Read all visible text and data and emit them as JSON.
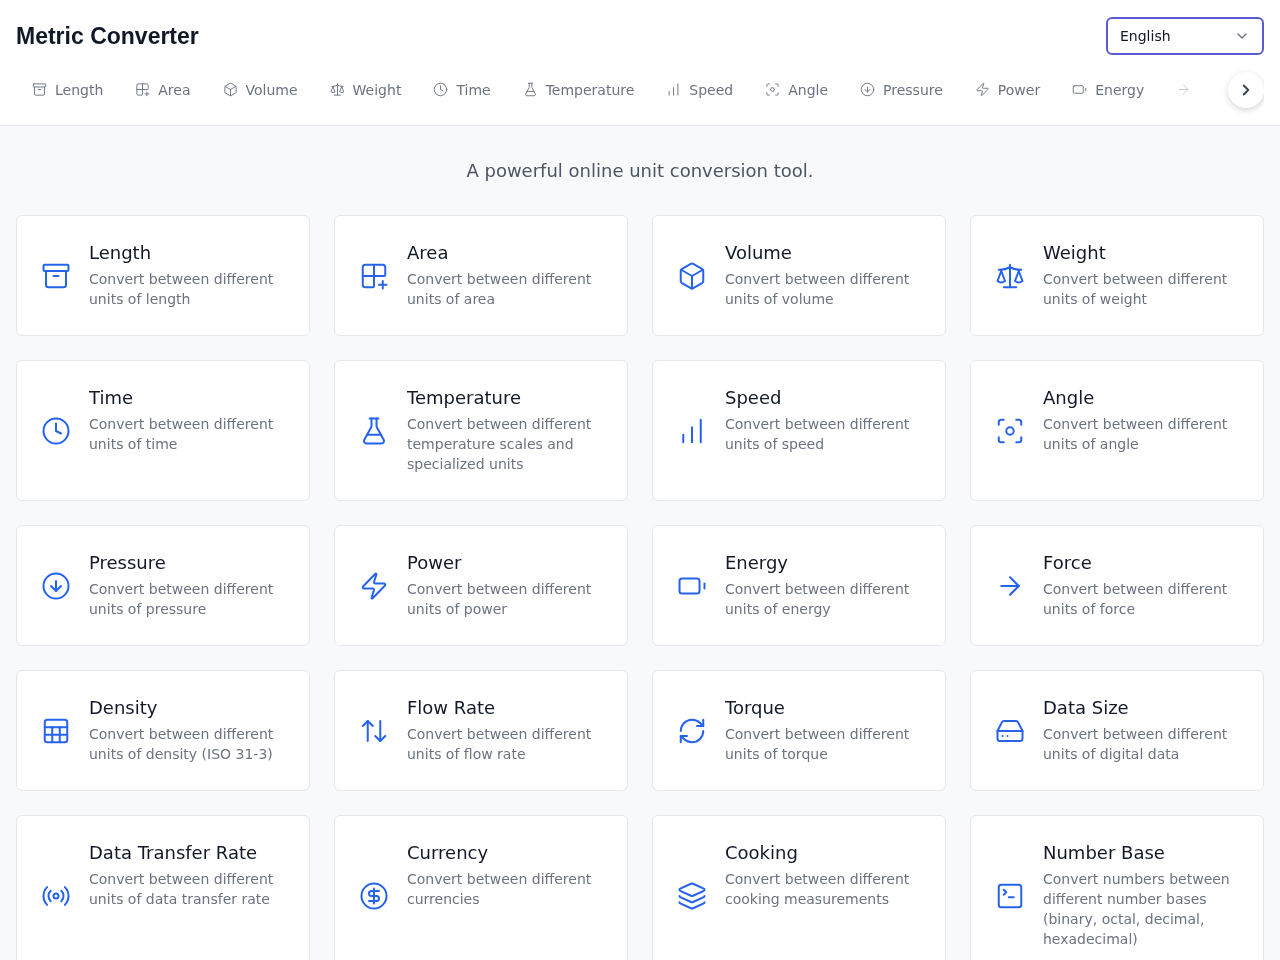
{
  "header": {
    "title": "Metric Converter",
    "language_select": {
      "value": "English"
    }
  },
  "tabs": [
    {
      "label": "Length",
      "selected": false
    },
    {
      "label": "Area",
      "selected": false
    },
    {
      "label": "Volume",
      "selected": false
    },
    {
      "label": "Weight",
      "selected": false
    },
    {
      "label": "Time",
      "selected": false
    },
    {
      "label": "Temperature",
      "selected": false
    },
    {
      "label": "Speed",
      "selected": false
    },
    {
      "label": "Angle",
      "selected": false
    },
    {
      "label": "Pressure",
      "selected": false
    },
    {
      "label": "Power",
      "selected": false
    },
    {
      "label": "Energy",
      "selected": false
    },
    {
      "selected": false
    }
  ],
  "tagline": "A powerful online unit conversion tool.",
  "cards": [
    {
      "title": "Length",
      "description": "Convert between different units of length"
    },
    {
      "title": "Area",
      "description": "Convert between different units of area"
    },
    {
      "title": "Volume",
      "description": "Convert between different units of volume"
    },
    {
      "title": "Weight",
      "description": "Convert between different units of weight"
    },
    {
      "title": "Time",
      "description": "Convert between different units of time"
    },
    {
      "title": "Temperature",
      "description": "Convert between different temperature scales and specialized units"
    },
    {
      "title": "Speed",
      "description": "Convert between different units of speed"
    },
    {
      "title": "Angle",
      "description": "Convert between different units of angle"
    },
    {
      "title": "Pressure",
      "description": "Convert between different units of pressure"
    },
    {
      "title": "Power",
      "description": "Convert between different units of power"
    },
    {
      "title": "Energy",
      "description": "Convert between different units of energy"
    },
    {
      "title": "Force",
      "description": "Convert between different units of force"
    },
    {
      "title": "Density",
      "description": "Convert between different units of density (ISO 31-3)"
    },
    {
      "title": "Flow Rate",
      "description": "Convert between different units of flow rate"
    },
    {
      "title": "Torque",
      "description": "Convert between different units of torque"
    },
    {
      "title": "Data Size",
      "description": "Convert between different units of digital data"
    },
    {
      "title": "Data Transfer Rate",
      "description": "Convert between different units of data transfer rate"
    },
    {
      "title": "Currency",
      "description": "Convert between different currencies"
    },
    {
      "title": "Cooking",
      "description": "Convert between different cooking measurements"
    },
    {
      "title": "Number Base",
      "description": "Convert numbers between different number bases (binary, octal, decimal, hexadecimal)"
    }
  ]
}
